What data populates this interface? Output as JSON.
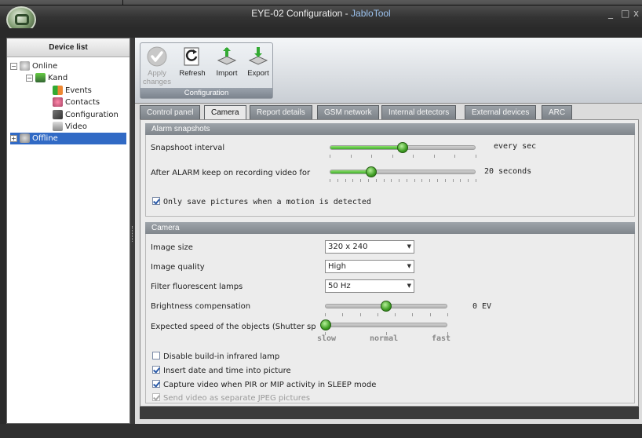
{
  "window": {
    "title_prefix": "EYE-02 Configuration - ",
    "title_brand": "JabloTool",
    "minimize": "_",
    "maximize": "□",
    "close": "x"
  },
  "device_list": {
    "header": "Device list",
    "items": [
      {
        "label": "Online",
        "expander": "−"
      },
      {
        "label": "Kand",
        "expander": "−"
      },
      {
        "label": "Events"
      },
      {
        "label": "Contacts"
      },
      {
        "label": "Configuration"
      },
      {
        "label": "Video"
      },
      {
        "label": "Offline",
        "expander": "+",
        "selected": true
      }
    ]
  },
  "ribbon": {
    "group_label": "Configuration",
    "apply_line1": "Apply",
    "apply_line2": "changes",
    "refresh": "Refresh",
    "import": "Import",
    "export": "Export"
  },
  "tabs": [
    "Control panel",
    "Camera",
    "Report details",
    "GSM network",
    "Internal detectors",
    "External devices",
    "ARC"
  ],
  "active_tab": "Camera",
  "alarm_snapshots": {
    "header": "Alarm snapshots",
    "interval_label": "Snapshoot interval",
    "interval_value": "every sec",
    "interval_slider_fraction": 0.5,
    "record_label": "After ALARM keep on recording video for",
    "record_value": "20 seconds",
    "record_slider_fraction": 0.28,
    "motion_only_label": "Only save pictures when a motion is detected",
    "motion_only_checked": true
  },
  "camera": {
    "header": "Camera",
    "image_size_label": "Image size",
    "image_size_value": "320 x 240",
    "image_quality_label": "Image quality",
    "image_quality_value": "High",
    "filter_label": "Filter fluorescent lamps",
    "filter_value": "50 Hz",
    "brightness_label": "Brightness compensation",
    "brightness_value": "0 EV",
    "brightness_slider_fraction": 0.5,
    "speed_label": "Expected speed of the objects (Shutter sp",
    "speed_slider_fraction": 0.0,
    "speed_slow": "slow",
    "speed_normal": "normal",
    "speed_fast": "fast",
    "disable_ir_label": "Disable build-in infrared lamp",
    "disable_ir_checked": false,
    "insert_date_label": "Insert date and time into picture",
    "insert_date_checked": true,
    "capture_video_label": "Capture video when PIR or MIP activity in SLEEP mode",
    "capture_video_checked": true,
    "send_jpeg_label": "Send video as separate JPEG pictures",
    "send_jpeg_checked": true
  },
  "colors": {
    "selection": "#316ac5",
    "slider_fill": "#3fae2a",
    "section_header": "#8a9096"
  }
}
